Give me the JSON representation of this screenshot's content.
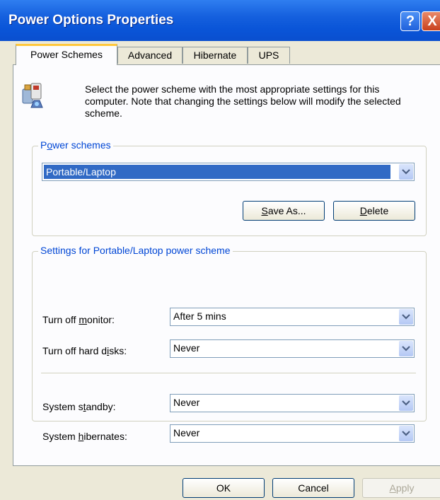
{
  "window": {
    "title": "Power Options Properties",
    "help_glyph": "?",
    "close_glyph": "X"
  },
  "tabs": [
    {
      "label": "Power Schemes",
      "active": true
    },
    {
      "label": "Advanced",
      "active": false
    },
    {
      "label": "Hibernate",
      "active": false
    },
    {
      "label": "UPS",
      "active": false
    }
  ],
  "description": "Select the power scheme with the most appropriate settings for this computer. Note that changing the settings below will modify the selected scheme.",
  "icon": "power-scheme-icon",
  "power_schemes": {
    "legend_pre": "P",
    "legend_key": "o",
    "legend_post": "wer schemes",
    "selected": "Portable/Laptop",
    "save_as_key": "S",
    "save_as_rest": "ave As...",
    "delete_key": "D",
    "delete_rest": "elete"
  },
  "settings": {
    "legend": "Settings for Portable/Laptop power scheme",
    "monitor": {
      "label_pre": "Turn off ",
      "label_key": "m",
      "label_post": "onitor:",
      "value": "After 5 mins"
    },
    "disks": {
      "label_pre": "Turn off hard d",
      "label_key": "i",
      "label_post": "sks:",
      "value": "Never"
    },
    "standby": {
      "label_pre": "System s",
      "label_key": "t",
      "label_post": "andby:",
      "value": "Never"
    },
    "hibernates": {
      "label_pre": "System ",
      "label_key": "h",
      "label_post": "ibernates:",
      "value": "Never"
    }
  },
  "dialog_buttons": {
    "ok": "OK",
    "cancel": "Cancel",
    "apply_key": "A",
    "apply_rest": "pply"
  },
  "colors": {
    "titlebar": "#0a55d8",
    "group_legend": "#0046d5",
    "selection": "#316ac5",
    "active_tab_accent": "#ffc83c"
  }
}
